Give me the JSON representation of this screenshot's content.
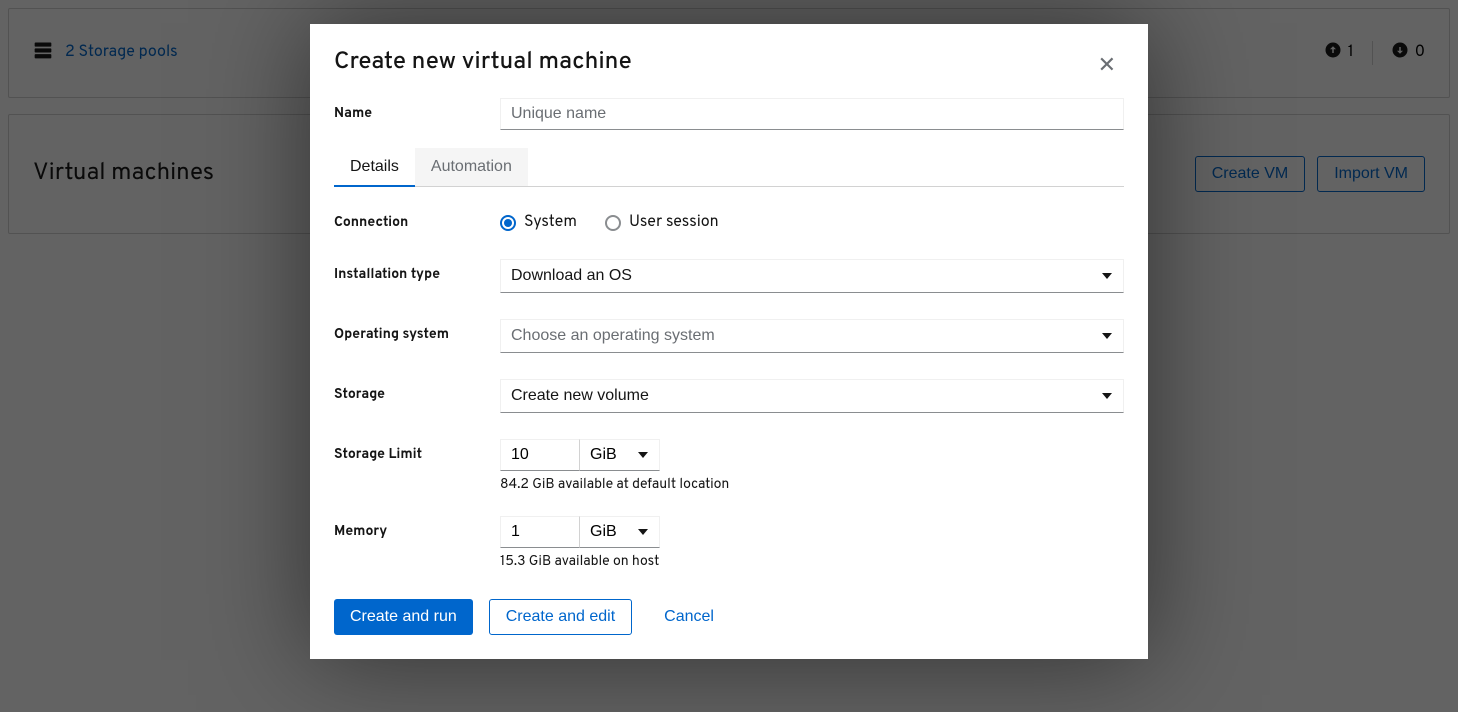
{
  "header": {
    "storage_pools_link": "2 Storage pools",
    "upload_count": "1",
    "download_count": "0"
  },
  "main": {
    "title": "Virtual machines",
    "create_vm_label": "Create VM",
    "import_vm_label": "Import VM"
  },
  "modal": {
    "title": "Create new virtual machine",
    "name_label": "Name",
    "name_placeholder": "Unique name",
    "tabs": {
      "details": "Details",
      "automation": "Automation"
    },
    "connection": {
      "label": "Connection",
      "system": "System",
      "user_session": "User session"
    },
    "install_type": {
      "label": "Installation type",
      "value": "Download an OS"
    },
    "os": {
      "label": "Operating system",
      "placeholder": "Choose an operating system"
    },
    "storage": {
      "label": "Storage",
      "value": "Create new volume"
    },
    "storage_limit": {
      "label": "Storage Limit",
      "value": "10",
      "unit": "GiB",
      "helper": "84.2 GiB available at default location"
    },
    "memory": {
      "label": "Memory",
      "value": "1",
      "unit": "GiB",
      "helper": "15.3 GiB available on host"
    },
    "footer": {
      "create_and_run": "Create and run",
      "create_and_edit": "Create and edit",
      "cancel": "Cancel"
    }
  }
}
